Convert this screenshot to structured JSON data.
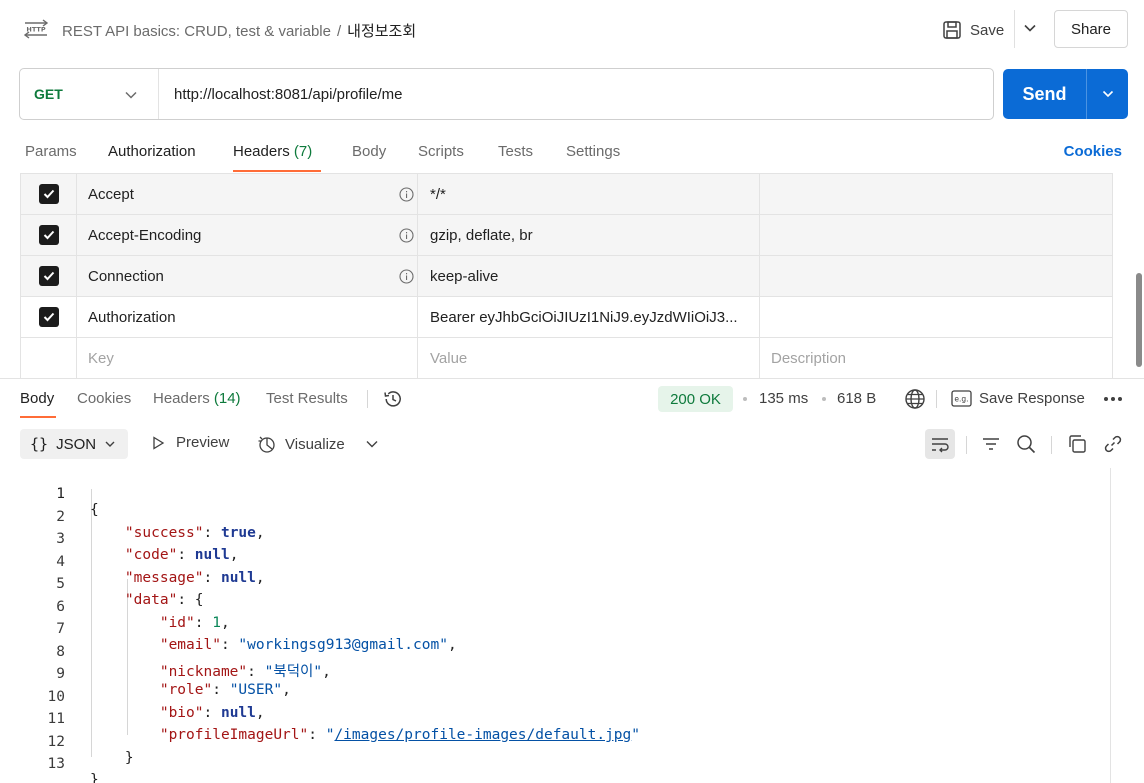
{
  "breadcrumb": {
    "collection": "REST API basics: CRUD, test & variable",
    "separator": "/",
    "request": "내정보조회"
  },
  "header_actions": {
    "save_label": "Save",
    "share_label": "Share"
  },
  "request": {
    "method": "GET",
    "url": "http://localhost:8081/api/profile/me",
    "send_label": "Send"
  },
  "request_tabs": {
    "params": "Params",
    "authorization": "Authorization",
    "headers": "Headers",
    "headers_count": "(7)",
    "body": "Body",
    "scripts": "Scripts",
    "tests": "Tests",
    "settings": "Settings",
    "cookies": "Cookies"
  },
  "headers_table": {
    "rows": [
      {
        "key": "Accept",
        "value": "*/*",
        "checked": true
      },
      {
        "key": "Accept-Encoding",
        "value": "gzip, deflate, br",
        "checked": true
      },
      {
        "key": "Connection",
        "value": "keep-alive",
        "checked": true
      },
      {
        "key": "Authorization",
        "value": "Bearer eyJhbGciOiJIUzI1NiJ9.eyJzdWIiOiJ3...",
        "checked": true
      }
    ],
    "placeholders": {
      "key": "Key",
      "value": "Value",
      "description": "Description"
    }
  },
  "response_tabs": {
    "body": "Body",
    "cookies": "Cookies",
    "headers": "Headers",
    "headers_count": "(14)",
    "test_results": "Test Results"
  },
  "response_meta": {
    "status": "200 OK",
    "time": "135 ms",
    "size": "618 B",
    "save_response": "Save Response",
    "status_color": "#0e7a3c"
  },
  "body_toolbar": {
    "format": "JSON",
    "preview": "Preview",
    "visualize": "Visualize"
  },
  "code_lines": {
    "l1": "1",
    "l2": "2",
    "l3": "3",
    "l4": "4",
    "l5": "5",
    "l6": "6",
    "l7": "7",
    "l8": "8",
    "l9": "9",
    "l10": "10",
    "l11": "11",
    "l12": "12",
    "l13": "13"
  },
  "response_json": {
    "success_key": "\"success\"",
    "success_val": "true",
    "code_key": "\"code\"",
    "code_val": "null",
    "message_key": "\"message\"",
    "message_val": "null",
    "data_key": "\"data\"",
    "id_key": "\"id\"",
    "id_val": "1",
    "email_key": "\"email\"",
    "email_val": "\"workingsg913@gmail.com\"",
    "nickname_key": "\"nickname\"",
    "nickname_val": "\"북덕이\"",
    "role_key": "\"role\"",
    "role_val": "\"USER\"",
    "bio_key": "\"bio\"",
    "bio_val": "null",
    "profile_key": "\"profileImageUrl\"",
    "profile_val": "/images/profile-images/default.jpg"
  },
  "colors": {
    "accent_orange": "#ff6c37",
    "send_blue": "#0b6bd6",
    "success_green": "#0e7a3c"
  }
}
